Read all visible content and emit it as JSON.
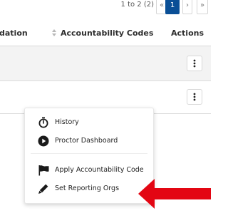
{
  "pagination": {
    "range_text": "1 to 2 (2)",
    "first_label": "«",
    "prev_label": "‹",
    "current_page": "1",
    "next_label": "›",
    "last_label": "»"
  },
  "table": {
    "columns": [
      {
        "label": "dation"
      },
      {
        "label": "Accountability Codes"
      },
      {
        "label": "Actions"
      }
    ],
    "rows": [
      {
        "actions_icon": "kebab-menu-icon"
      },
      {
        "actions_icon": "kebab-menu-icon"
      }
    ]
  },
  "action_menu": {
    "items": [
      {
        "label": "History",
        "icon": "timer-icon"
      },
      {
        "label": "Proctor Dashboard",
        "icon": "play-circle-icon"
      },
      {
        "label": "Apply Accountability Code",
        "icon": "flag-icon"
      },
      {
        "label": "Set Reporting Orgs",
        "icon": "pen-icon"
      }
    ]
  },
  "colors": {
    "accent": "#0a4f96",
    "annotation_arrow": "#e30613",
    "row_alt_bg": "#f3f3f3"
  }
}
